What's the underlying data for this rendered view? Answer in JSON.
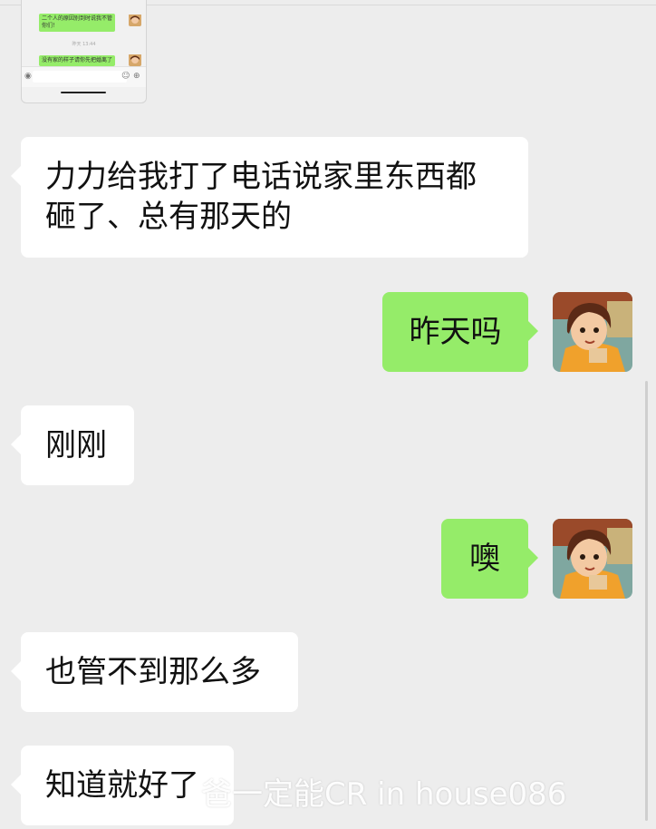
{
  "thumbnail": {
    "messages": [
      {
        "text": "二个人的原因别到时说我不管\n你们！",
        "side": "right"
      },
      {
        "text": "没有家的样子请你先把婚离了",
        "side": "right"
      }
    ],
    "time": "昨天 13:44"
  },
  "chat": {
    "messages": [
      {
        "side": "left",
        "lines": [
          "力力给我打了电话说家里东西都",
          "砸了、总有那天的"
        ]
      },
      {
        "side": "right",
        "text": "昨天吗"
      },
      {
        "side": "left",
        "text": "刚刚"
      },
      {
        "side": "right",
        "text": "噢"
      },
      {
        "side": "left",
        "text": "也管不到那么多"
      },
      {
        "side": "left",
        "text": "知道就好了"
      }
    ]
  },
  "avatar": {
    "icon": "cartoon-girl-avatar-icon"
  },
  "watermark": "爸一定能CR in house086",
  "colors": {
    "background": "#ededed",
    "sent_bubble": "#95ec69",
    "received_bubble": "#ffffff"
  }
}
